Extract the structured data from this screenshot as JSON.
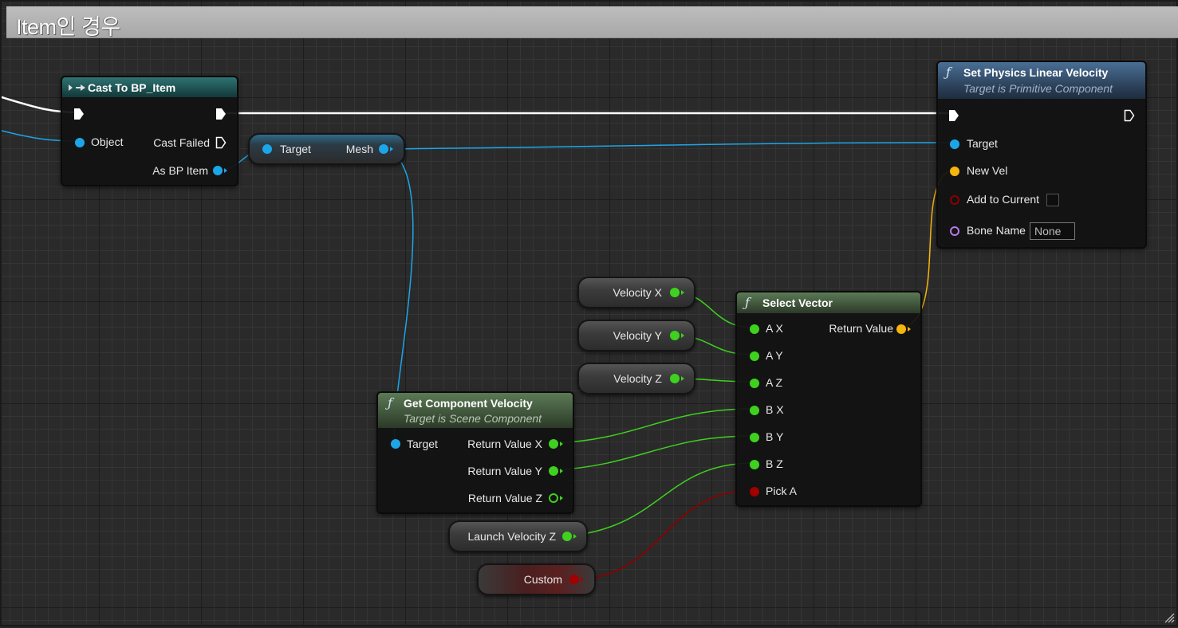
{
  "comment": {
    "title": "Item인 경우"
  },
  "cast_node": {
    "title": "Cast To BP_Item",
    "pins": {
      "object": "Object",
      "cast_failed": "Cast Failed",
      "as_bp_item": "As BP Item"
    }
  },
  "mesh_node": {
    "target": "Target",
    "mesh": "Mesh"
  },
  "set_velocity_node": {
    "title": "Set Physics Linear Velocity",
    "subtitle": "Target is Primitive Component",
    "pins": {
      "target": "Target",
      "new_vel": "New Vel",
      "add_to_current": "Add to Current",
      "bone_name": "Bone Name"
    },
    "bone_name_value": "None"
  },
  "velocity_vars": {
    "x": "Velocity X",
    "y": "Velocity Y",
    "z": "Velocity Z"
  },
  "select_vector_node": {
    "title": "Select Vector",
    "pins": {
      "ax": "A X",
      "ay": "A Y",
      "az": "A Z",
      "bx": "B X",
      "by": "B Y",
      "bz": "B Z",
      "pick_a": "Pick A",
      "return_value": "Return Value"
    }
  },
  "get_velocity_node": {
    "title": "Get Component Velocity",
    "subtitle": "Target is Scene Component",
    "pins": {
      "target": "Target",
      "rx": "Return Value X",
      "ry": "Return Value Y",
      "rz": "Return Value Z"
    }
  },
  "launch_var": {
    "label": "Launch Velocity Z"
  },
  "custom_var": {
    "label": "Custom"
  },
  "colors": {
    "exec": "#ffffff",
    "object_pin": "#1ca6e8",
    "float_pin": "#3ed11f",
    "vector_pin": "#f5b50c",
    "bool_pin": "#a00000",
    "name_pin": "#b87ae6"
  }
}
